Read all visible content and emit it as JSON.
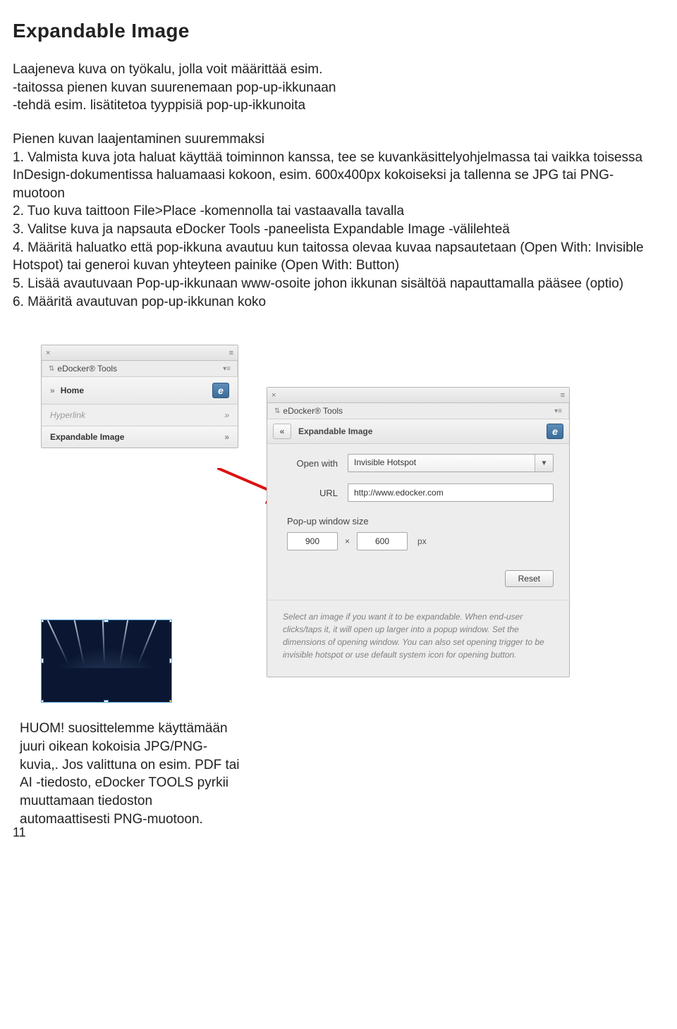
{
  "page": {
    "title": "Expandable Image",
    "intro_line1": "Laajeneva kuva on työkalu, jolla voit määrittää esim.",
    "intro_line2": "-taitossa pienen kuvan suurenemaan pop-up-ikkunaan",
    "intro_line3": "-tehdä esim. lisätitetoa tyyppisiä pop-up-ikkunoita",
    "sub_heading": "Pienen kuvan laajentaminen suuremmaksi",
    "step1": "1. Valmista kuva jota haluat käyttää toiminnon kanssa, tee se kuvankäsittelyohjelmassa tai vaikka toisessa InDesign-dokumentissa haluamaasi kokoon, esim. 600x400px kokoiseksi ja tallenna se JPG tai PNG-muotoon",
    "step2": "2. Tuo kuva taittoon File>Place -komennolla tai vastaavalla tavalla",
    "step3": "3. Valitse kuva ja napsauta eDocker Tools -paneelista Expandable Image -välilehteä",
    "step4": "4. Määritä haluatko että pop-ikkuna avautuu kun taitossa olevaa kuvaa napsautetaan (Open With: Invisible Hotspot) tai generoi kuvan yhteyteen painike (Open With: Button)",
    "step5": "5. Lisää avautuvaan Pop-up-ikkunaan www-osoite johon ikkunan sisältöä napauttamalla pääsee (optio)",
    "step6": "6. Määritä avautuvan pop-up-ikkunan koko",
    "note": "HUOM! suosittelemme käyttämään juuri oikean kokoisia JPG/PNG-kuvia,. Jos valittuna on esim. PDF tai AI -tiedosto, eDocker TOOLS pyrkii muuttamaan tiedoston automaattisesti PNG-muotoon.",
    "page_number": "11"
  },
  "small_panel": {
    "tab_title": "eDocker® Tools",
    "rows": {
      "home": "Home",
      "hyperlink": "Hyperlink",
      "expandable": "Expandable Image"
    },
    "badge": "e"
  },
  "large_panel": {
    "tab_title": "eDocker® Tools",
    "section": "Expandable Image",
    "badge": "e",
    "open_with_label": "Open with",
    "open_with_value": "Invisible Hotspot",
    "url_label": "URL",
    "url_value": "http://www.edocker.com",
    "popup_label": "Pop-up window size",
    "width": "900",
    "height": "600",
    "times": "×",
    "px": "px",
    "reset": "Reset",
    "help": "Select an image if you want it to be expandable. When end-user clicks/taps it, it will open up larger into a popup window. Set the dimensions of opening window. You can also set opening trigger to be invisible hotspot or use default system icon for opening button."
  }
}
